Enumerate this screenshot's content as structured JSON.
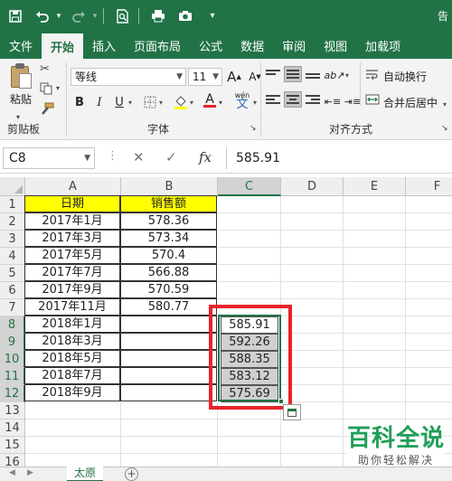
{
  "window": {
    "title_fragment": "告"
  },
  "quick_access": [
    {
      "name": "save-icon",
      "glyph": "🖫"
    },
    {
      "name": "undo-icon",
      "glyph": "↶"
    },
    {
      "name": "redo-icon",
      "glyph": "↷"
    },
    {
      "name": "print-preview-icon",
      "glyph": "🔍"
    },
    {
      "name": "printer-icon",
      "glyph": "🖶"
    },
    {
      "name": "camera-icon",
      "glyph": "📷"
    },
    {
      "name": "customize-icon",
      "glyph": "▾"
    }
  ],
  "tabs": [
    {
      "label": "文件",
      "active": false
    },
    {
      "label": "开始",
      "active": true
    },
    {
      "label": "插入",
      "active": false
    },
    {
      "label": "页面布局",
      "active": false
    },
    {
      "label": "公式",
      "active": false
    },
    {
      "label": "数据",
      "active": false
    },
    {
      "label": "审阅",
      "active": false
    },
    {
      "label": "视图",
      "active": false
    },
    {
      "label": "加载项",
      "active": false
    }
  ],
  "ribbon": {
    "clipboard": {
      "paste_label": "粘贴",
      "group_label": "剪贴板"
    },
    "font": {
      "font_name": "等线",
      "font_size": "11",
      "grow_label": "A",
      "shrink_label": "A",
      "bold": "B",
      "italic": "I",
      "underline": "U",
      "font_color_letter": "A",
      "phonetic_label": "wén",
      "group_label": "字体"
    },
    "alignment": {
      "wrap_text": "自动换行",
      "merge_center": "合并后居中",
      "group_label": "对齐方式"
    }
  },
  "formula_bar": {
    "name_box": "C8",
    "fx_label": "fx",
    "value": "585.91"
  },
  "grid": {
    "columns": [
      {
        "label": "A",
        "selected": false
      },
      {
        "label": "B",
        "selected": false
      },
      {
        "label": "C",
        "selected": true
      },
      {
        "label": "D",
        "selected": false
      },
      {
        "label": "E",
        "selected": false
      },
      {
        "label": "F",
        "selected": false
      }
    ],
    "rows": [
      "1",
      "2",
      "3",
      "4",
      "5",
      "6",
      "7",
      "8",
      "9",
      "10",
      "11",
      "12",
      "13",
      "14",
      "15",
      "16",
      "17"
    ],
    "selected_rows": [
      "8",
      "9",
      "10",
      "11",
      "12"
    ],
    "header": {
      "a": "日期",
      "b": "销售额"
    },
    "data": [
      {
        "a": "2017年1月",
        "b": "578.36",
        "c": ""
      },
      {
        "a": "2017年3月",
        "b": "573.34",
        "c": ""
      },
      {
        "a": "2017年5月",
        "b": "570.4",
        "c": ""
      },
      {
        "a": "2017年7月",
        "b": "566.88",
        "c": ""
      },
      {
        "a": "2017年9月",
        "b": "570.59",
        "c": ""
      },
      {
        "a": "2017年11月",
        "b": "580.77",
        "c": ""
      },
      {
        "a": "2018年1月",
        "b": "",
        "c": "585.91"
      },
      {
        "a": "2018年3月",
        "b": "",
        "c": "592.26"
      },
      {
        "a": "2018年5月",
        "b": "",
        "c": "588.35"
      },
      {
        "a": "2018年7月",
        "b": "",
        "c": "583.12"
      },
      {
        "a": "2018年9月",
        "b": "",
        "c": "575.69"
      }
    ]
  },
  "sheets": [
    {
      "label": "太原",
      "active": true
    }
  ],
  "watermark": {
    "main": "百科全说",
    "sub": "助你轻松解决"
  },
  "colors": {
    "accent": "#217346",
    "header_fill": "#ffff00",
    "highlight_fill": "#d0d0d0",
    "annotation_red": "#e8232a",
    "watermark_green": "#1f9e57"
  }
}
